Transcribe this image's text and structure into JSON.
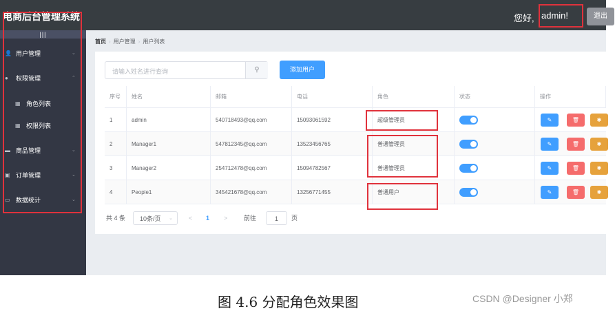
{
  "header": {
    "title": "电商后台管理系统",
    "greeting": "您好,",
    "username": "admin!",
    "logout_label": "退出"
  },
  "sidebar": {
    "toggle_label": "|||",
    "items": [
      {
        "label": "用户管理",
        "icon": "user-icon",
        "glyph": "👤",
        "arrow": "⌄",
        "sub": false
      },
      {
        "label": "权限管理",
        "icon": "lock-icon",
        "glyph": "●",
        "arrow": "⌃",
        "sub": false
      },
      {
        "label": "角色列表",
        "icon": "grid-icon",
        "glyph": "▦",
        "arrow": "",
        "sub": true
      },
      {
        "label": "权限列表",
        "icon": "grid-icon",
        "glyph": "▦",
        "arrow": "",
        "sub": true
      },
      {
        "label": "商品管理",
        "icon": "goods-icon",
        "glyph": "▬",
        "arrow": "⌄",
        "sub": false
      },
      {
        "label": "订单管理",
        "icon": "order-icon",
        "glyph": "▣",
        "arrow": "⌄",
        "sub": false
      },
      {
        "label": "数据统计",
        "icon": "chart-icon",
        "glyph": "▭",
        "arrow": "⌄",
        "sub": false
      }
    ]
  },
  "breadcrumb": [
    "首页",
    "用户管理",
    "用户列表"
  ],
  "search": {
    "placeholder": "请输入姓名进行查询",
    "button_icon": "search-icon"
  },
  "add_button": "添加用户",
  "table": {
    "headers": [
      "序号",
      "姓名",
      "邮箱",
      "电话",
      "角色",
      "状态",
      "操作"
    ],
    "rows": [
      {
        "index": "1",
        "name": "admin",
        "email": "540718493@qq.com",
        "phone": "15093061592",
        "role": "超级管理员",
        "status": true
      },
      {
        "index": "2",
        "name": "Manager1",
        "email": "547812345@qq.com",
        "phone": "13523456765",
        "role": "普通管理员",
        "status": true
      },
      {
        "index": "3",
        "name": "Manager2",
        "email": "254712478@qq.com",
        "phone": "15094782567",
        "role": "普通管理员",
        "status": true
      },
      {
        "index": "4",
        "name": "People1",
        "email": "345421678@qq.com",
        "phone": "13256771455",
        "role": "普通用户",
        "status": true
      }
    ],
    "action_icons": [
      "edit-icon",
      "delete-icon",
      "setting-icon"
    ]
  },
  "pagination": {
    "total": "共 4 条",
    "page_size": "10条/页",
    "prev": "<",
    "current": "1",
    "next": ">",
    "goto_prefix": "前往",
    "goto_value": "1",
    "goto_suffix": "页"
  },
  "caption": "图 4.6 分配角色效果图",
  "watermark": "CSDN @Designer 小郑",
  "colors": {
    "header_bg": "#373d41",
    "sidebar_bg": "#333744",
    "primary": "#409eff",
    "danger": "#f56c6c",
    "warning": "#e6a23c",
    "highlight_box": "#e0323c"
  }
}
